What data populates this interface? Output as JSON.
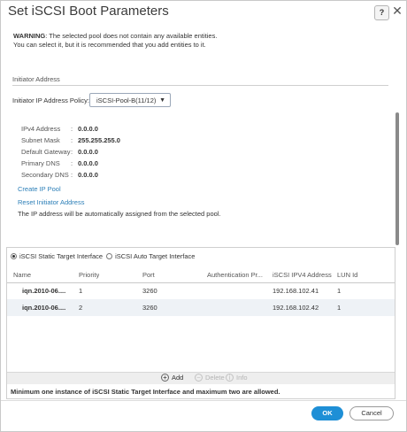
{
  "dialog": {
    "title": "Set iSCSI Boot Parameters",
    "help_label": "?",
    "close_label": "✕"
  },
  "warning": {
    "label": "WARNING",
    "line1_rest": ": The selected pool does not contain any available entities.",
    "line2": "You can select it, but it is recommended that you add entities to it."
  },
  "initiator": {
    "section_title": "Initiator Address",
    "policy_label": "Initiator IP Address Policy:",
    "policy_value": "iSCSI-Pool-B(11/12)",
    "fields": [
      {
        "label": "IPv4 Address",
        "sep": ":",
        "value": "0.0.0.0"
      },
      {
        "label": "Subnet Mask",
        "sep": ":",
        "value": "255.255.255.0"
      },
      {
        "label": "Default Gateway",
        "sep": ":",
        "value": "0.0.0.0"
      },
      {
        "label": "Primary DNS",
        "sep": ":",
        "value": "0.0.0.0"
      },
      {
        "label": "Secondary DNS",
        "sep": ":",
        "value": "0.0.0.0"
      }
    ],
    "create_ip_pool": "Create IP Pool",
    "reset_initiator": "Reset Initiator Address",
    "note": "The IP address will be automatically assigned from the selected pool."
  },
  "target": {
    "static_label": "iSCSI Static Target Interface",
    "auto_label": "iSCSI Auto Target Interface",
    "columns": [
      "Name",
      "Priority",
      "Port",
      "Authentication Pr...",
      "iSCSI IPV4 Address",
      "LUN Id"
    ],
    "rows": [
      {
        "name": "iqn.2010-06....",
        "priority": "1",
        "port": "3260",
        "auth": "",
        "ip": "192.168.102.41",
        "lun": "1"
      },
      {
        "name": "iqn.2010-06....",
        "priority": "2",
        "port": "3260",
        "auth": "",
        "ip": "192.168.102.42",
        "lun": "1"
      }
    ],
    "actions": {
      "add": "Add",
      "delete": "Delete",
      "info": "Info"
    },
    "min_note": "Minimum one instance of iSCSI Static Target Interface and maximum two are allowed."
  },
  "footer": {
    "ok": "OK",
    "cancel": "Cancel"
  },
  "colors": {
    "accent": "#1e8fd6",
    "link": "#2c7fb8",
    "row_alt": "#eef2f6"
  }
}
